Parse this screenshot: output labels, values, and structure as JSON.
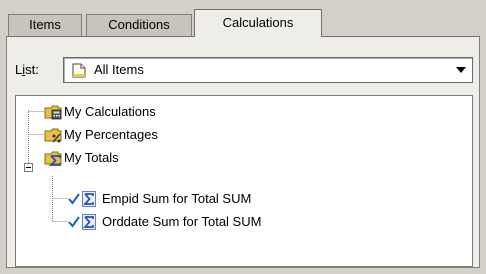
{
  "tabs": [
    {
      "label": "Items",
      "selected": false
    },
    {
      "label": "Conditions",
      "selected": false
    },
    {
      "label": "Calculations",
      "selected": true
    }
  ],
  "list": {
    "label_prefix": "L",
    "label_underlined": "i",
    "label_suffix": "st:",
    "selected_value": "All Items",
    "icon": "document-icon"
  },
  "tree": {
    "nodes": [
      {
        "label": "My Calculations",
        "icon": "folder-calculator-icon",
        "level": 0
      },
      {
        "label": "My Percentages",
        "icon": "folder-percent-icon",
        "level": 0
      },
      {
        "label": "My Totals",
        "icon": "folder-sigma-icon",
        "level": 0,
        "expanded": true
      },
      {
        "label": "Empid Sum for Total SUM",
        "icon": "sigma-icon",
        "checked": true,
        "level": 1
      },
      {
        "label": "Orddate Sum for Total SUM",
        "icon": "sigma-icon",
        "checked": true,
        "level": 1
      }
    ]
  },
  "colors": {
    "background": "#d4d0c8",
    "panel": "#efede7",
    "folder": "#e8c050",
    "check": "#1f5fbf",
    "sigma": "#2b4fa8"
  }
}
